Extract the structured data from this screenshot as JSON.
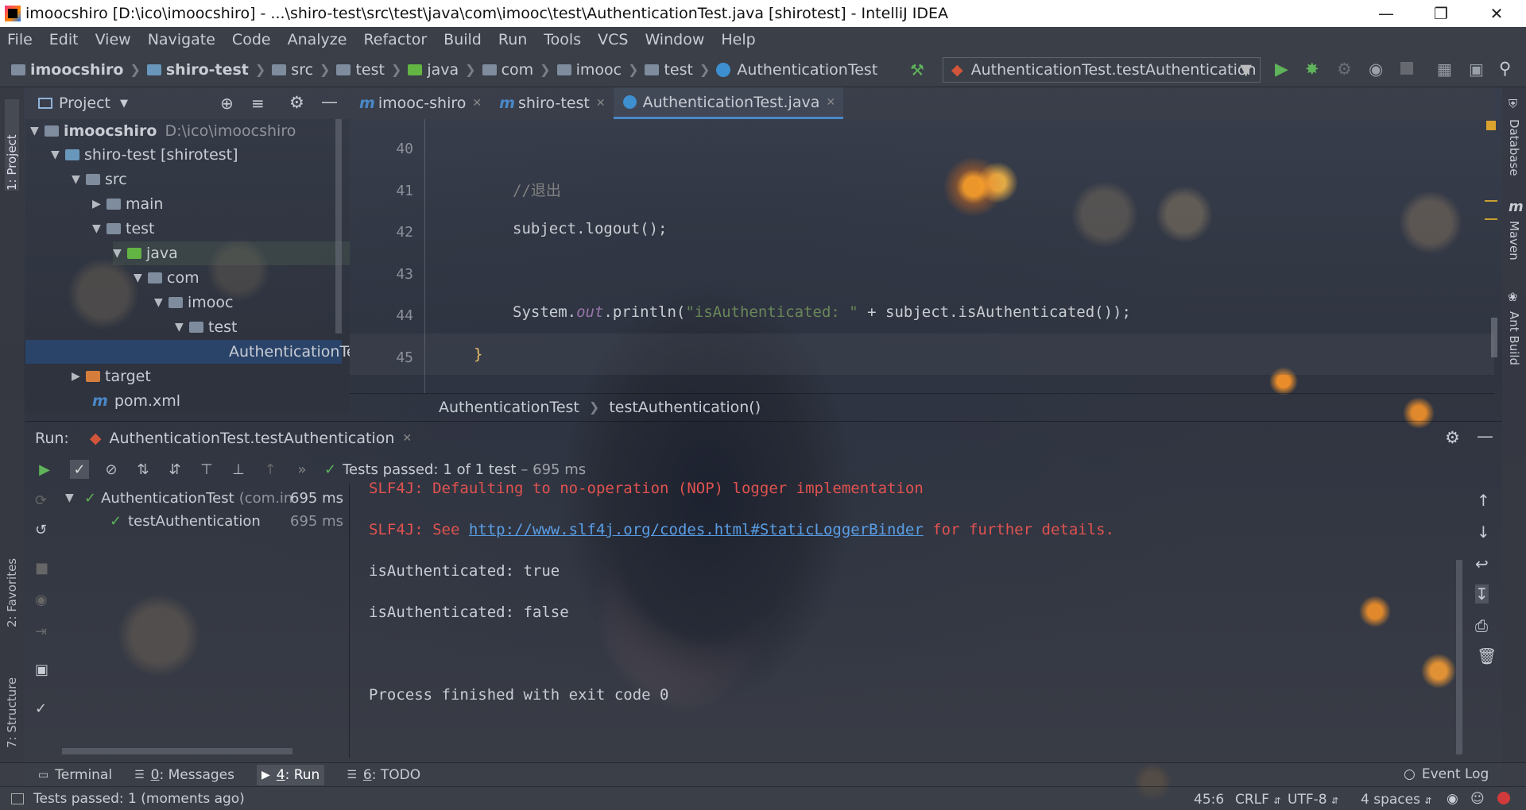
{
  "window": {
    "title": "imoocshiro [D:\\ico\\imoocshiro] - ...\\shiro-test\\src\\test\\java\\com\\imooc\\test\\AuthenticationTest.java [shirotest] - IntelliJ IDEA"
  },
  "menu": [
    "File",
    "Edit",
    "View",
    "Navigate",
    "Code",
    "Analyze",
    "Refactor",
    "Build",
    "Run",
    "Tools",
    "VCS",
    "Window",
    "Help"
  ],
  "nav": {
    "crumbs": [
      "imoocshiro",
      "shiro-test",
      "src",
      "test",
      "java",
      "com",
      "imooc",
      "test",
      "AuthenticationTest"
    ],
    "run_config": "AuthenticationTest.testAuthentication"
  },
  "project": {
    "header": "Project",
    "tree": [
      {
        "label": "imoocshiro",
        "extra": "D:\\ico\\imoocshiro"
      },
      {
        "label": "shiro-test [shirotest]"
      },
      {
        "label": "src"
      },
      {
        "label": "main"
      },
      {
        "label": "test"
      },
      {
        "label": "java"
      },
      {
        "label": "com"
      },
      {
        "label": "imooc"
      },
      {
        "label": "test"
      },
      {
        "label": "AuthenticationTest"
      },
      {
        "label": "target"
      },
      {
        "label": "pom.xml"
      }
    ]
  },
  "editor": {
    "tabs": [
      "imooc-shiro",
      "shiro-test",
      "AuthenticationTest.java"
    ],
    "lines": [
      {
        "no": "40",
        "text": ""
      },
      {
        "no": "41",
        "text": "//退出"
      },
      {
        "no": "42",
        "text": "subject.logout();"
      },
      {
        "no": "43",
        "text": ""
      },
      {
        "no": "44",
        "code_obj": "System.",
        "code_field": "out",
        "code_call": ".println(",
        "code_str": "\"isAuthenticated: \"",
        "code_rest": "+ subject.isAuthenticated());"
      },
      {
        "no": "45",
        "text": "}"
      }
    ],
    "breadcrumb": [
      "AuthenticationTest",
      "testAuthentication()"
    ]
  },
  "right_tools": [
    "Database",
    "Maven",
    "Ant Build"
  ],
  "left_tools": [
    "1: Project",
    "2: Favorites",
    "7: Structure"
  ],
  "run": {
    "label": "Run:",
    "config": "AuthenticationTest.testAuthentication",
    "status": "Tests passed:",
    "status_count": "1 of 1 test",
    "status_time": "– 695 ms",
    "tree": [
      {
        "label": "AuthenticationTest",
        "sub": "(com.in",
        "time": "695 ms"
      },
      {
        "label": "testAuthentication",
        "time": "695 ms"
      }
    ],
    "console": {
      "slf4j_1": "SLF4J: Defaulting to no-operation (NOP) logger implementation",
      "slf4j_2_pre": "SLF4J: See ",
      "slf4j_2_link": "http://www.slf4j.org/codes.html#StaticLoggerBinder",
      "slf4j_2_post": " for further details.",
      "out1": "isAuthenticated: true",
      "out2": "isAuthenticated: false",
      "finished": "Process finished with exit code 0"
    }
  },
  "toolwindows": [
    {
      "num": "",
      "label": "Terminal"
    },
    {
      "num": "0",
      "label": ": Messages"
    },
    {
      "num": "4",
      "label": ": Run"
    },
    {
      "num": "6",
      "label": ": TODO"
    }
  ],
  "event_log": "Event Log",
  "statusbar": {
    "message": "Tests passed: 1 (moments ago)",
    "position": "45:6",
    "line_sep": "CRLF",
    "encoding": "UTF-8",
    "indent": "4 spaces"
  },
  "colors": {
    "accent": "#4a88c7",
    "pass": "#5fb35a",
    "error": "#e0524f",
    "link": "#5a9ee6",
    "string": "#6a8759",
    "comment": "#808080"
  }
}
